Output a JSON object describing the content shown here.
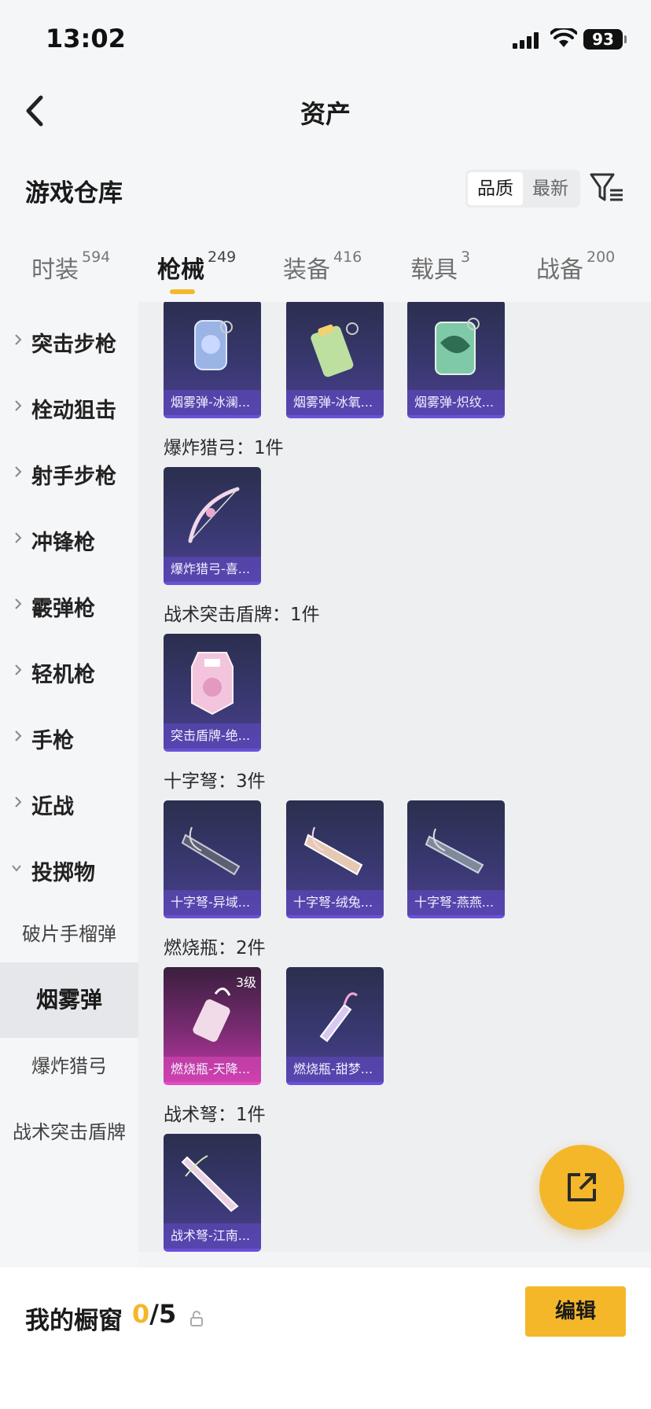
{
  "status_bar": {
    "time": "13:02",
    "battery": "93"
  },
  "nav": {
    "title": "资产"
  },
  "warehouse": {
    "title": "游戏仓库",
    "sort_options": [
      "品质",
      "最新"
    ],
    "sort_active": "品质"
  },
  "tabs": [
    {
      "label": "时装",
      "count": "594"
    },
    {
      "label": "枪械",
      "count": "249",
      "active": true
    },
    {
      "label": "装备",
      "count": "416"
    },
    {
      "label": "载具",
      "count": "3"
    },
    {
      "label": "战备",
      "count": "200"
    }
  ],
  "sidebar": {
    "categories": [
      "突击步枪",
      "栓动狙击",
      "射手步枪",
      "冲锋枪",
      "霰弹枪",
      "轻机枪",
      "手枪",
      "近战",
      "投掷物"
    ],
    "subitems": [
      "破片手榴弹",
      "烟雾弹",
      "爆炸猎弓",
      "战术突击盾牌"
    ],
    "active_subitem": "烟雾弹"
  },
  "content": {
    "top_row_cards": [
      "烟雾弹-冰澜...",
      "烟雾弹-冰氧...",
      "烟雾弹-炽纹..."
    ],
    "sections": [
      {
        "title": "爆炸猎弓：1件",
        "cards": [
          "爆炸猎弓-喜..."
        ]
      },
      {
        "title": "战术突击盾牌：1件",
        "cards": [
          "突击盾牌-绝..."
        ]
      },
      {
        "title": "十字弩：3件",
        "cards": [
          "十字弩-异域...",
          "十字弩-绒兔...",
          "十字弩-燕燕..."
        ]
      },
      {
        "title": "燃烧瓶：2件",
        "cards": [
          "燃烧瓶-天降...",
          "燃烧瓶-甜梦..."
        ],
        "first_card_level": "3级"
      },
      {
        "title": "战术弩：1件",
        "cards": [
          "战术弩-江南..."
        ]
      }
    ]
  },
  "bottom_bar": {
    "title": "我的橱窗",
    "current": "0",
    "separator": "/5",
    "edit_label": "编辑"
  },
  "colors": {
    "accent": "#f4b72a",
    "card_purple": "#383870",
    "card_pink": "#c038a6"
  }
}
